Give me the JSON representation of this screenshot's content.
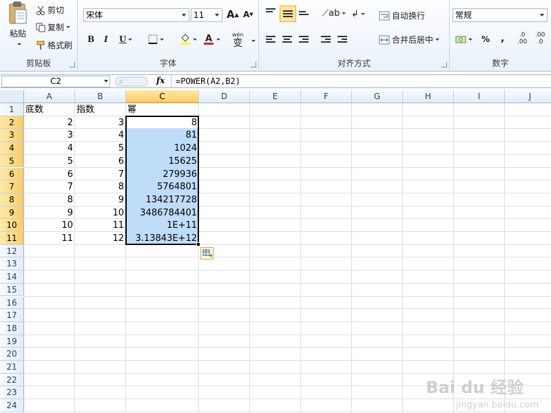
{
  "ribbon": {
    "clipboard": {
      "paste": "粘贴",
      "cut": "剪切",
      "copy": "复制",
      "format_painter": "格式刷",
      "label": "剪贴板"
    },
    "font": {
      "family": "宋体",
      "size": "11",
      "bold": "B",
      "italic": "I",
      "underline": "U",
      "grow": "A",
      "wen": "wén",
      "bian": "变",
      "label": "字体"
    },
    "alignment": {
      "wrap_text": "自动换行",
      "merge_center": "合并后居中",
      "label": "对齐方式"
    },
    "number": {
      "format": "常规",
      "percent": "%",
      "comma": ",",
      "inc_decimal": ".00",
      "dec_decimal": ".0",
      "label": "数字"
    }
  },
  "formula_bar": {
    "name_box": "C2",
    "fx": "fx",
    "formula": "=POWER(A2,B2)"
  },
  "grid": {
    "columns": [
      "A",
      "B",
      "C",
      "D",
      "E",
      "F",
      "G",
      "H",
      "I",
      "J"
    ],
    "rows": [
      "1",
      "2",
      "3",
      "4",
      "5",
      "6",
      "7",
      "8",
      "9",
      "10",
      "11",
      "12",
      "13",
      "14",
      "15",
      "16",
      "17",
      "18",
      "19",
      "20",
      "21",
      "22",
      "23",
      "24"
    ],
    "headers": {
      "a": "底数",
      "b": "指数",
      "c": "幂"
    },
    "data": [
      {
        "a": "2",
        "b": "3",
        "c": "8"
      },
      {
        "a": "3",
        "b": "4",
        "c": "81"
      },
      {
        "a": "4",
        "b": "5",
        "c": "1024"
      },
      {
        "a": "5",
        "b": "6",
        "c": "15625"
      },
      {
        "a": "6",
        "b": "7",
        "c": "279936"
      },
      {
        "a": "7",
        "b": "8",
        "c": "5764801"
      },
      {
        "a": "8",
        "b": "9",
        "c": "134217728"
      },
      {
        "a": "9",
        "b": "10",
        "c": "3486784401"
      },
      {
        "a": "10",
        "b": "11",
        "c": "1E+11"
      },
      {
        "a": "11",
        "b": "12",
        "c": "3.13843E+12"
      }
    ],
    "active_column": "C",
    "active_rows": [
      "2",
      "3",
      "4",
      "5",
      "6",
      "7",
      "8",
      "9",
      "10",
      "11"
    ]
  },
  "watermark": {
    "main": "Bai du 经验",
    "sub": "jingyan.baidu.com"
  },
  "colors": {
    "selection": "#bfdcf8",
    "header_active": "#f7cd6a",
    "ribbon_bg": "#eaf1fa"
  }
}
